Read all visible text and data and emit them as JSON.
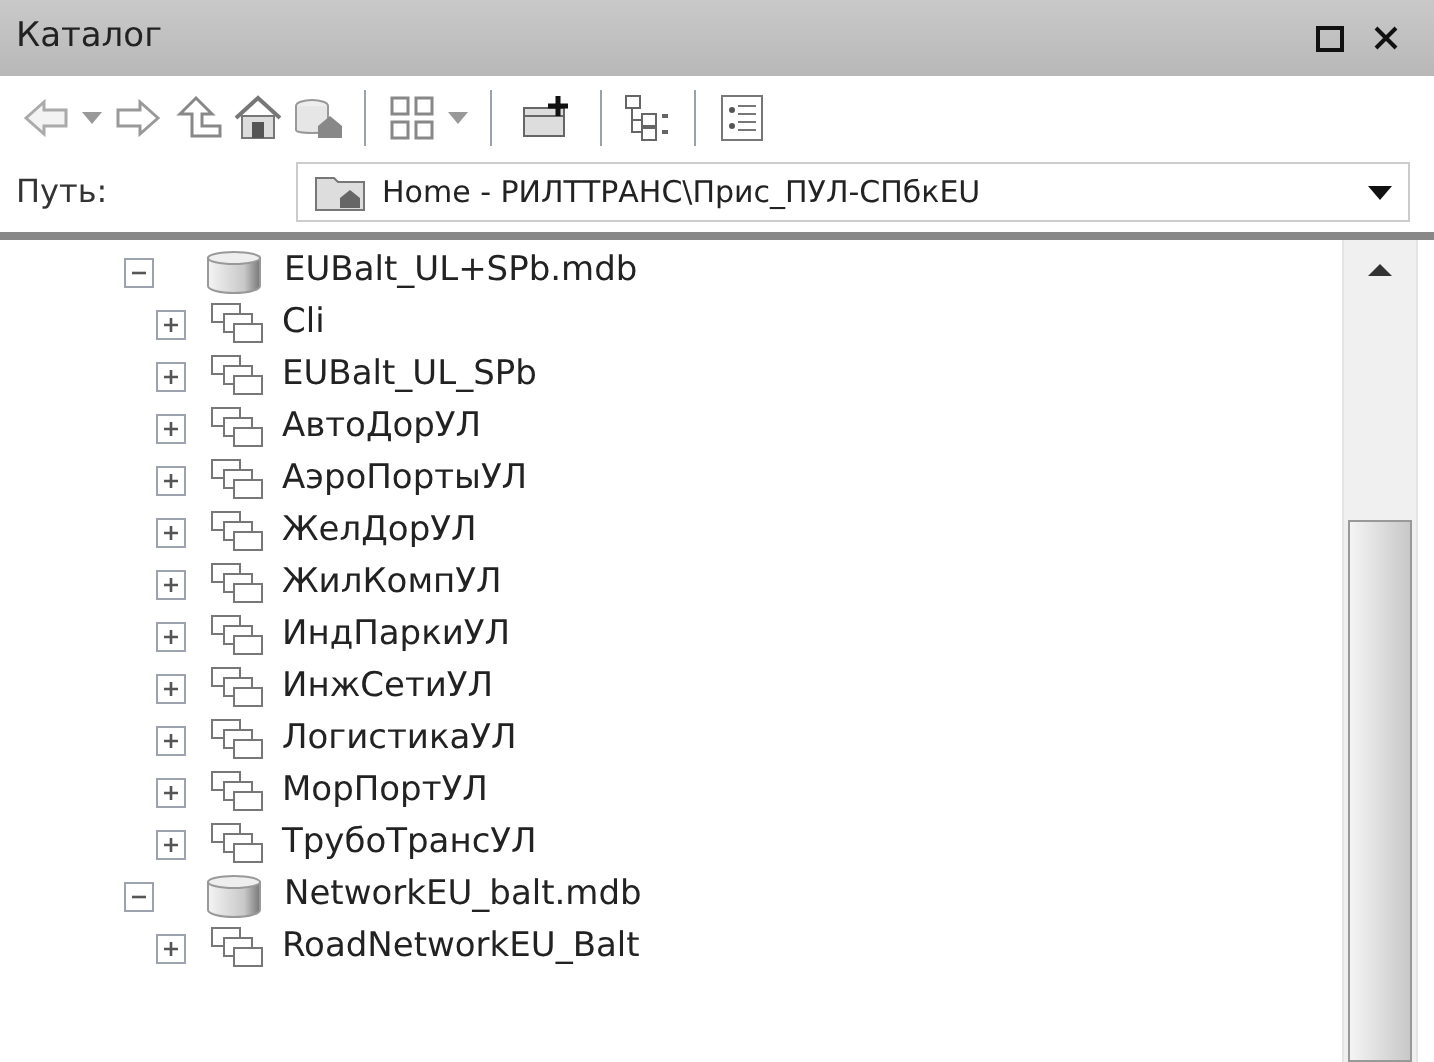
{
  "window": {
    "title": "Каталог"
  },
  "path": {
    "label": "Путь:",
    "value": "Home - РИЛТТРАНС\\Прис_ПУЛ-СПбкEU"
  },
  "tree": [
    {
      "label": "EUBalt_UL+SPb.mdb",
      "kind": "database",
      "expanded": true,
      "children": [
        {
          "label": "Cli",
          "kind": "dataset",
          "expanded": false
        },
        {
          "label": "EUBalt_UL_SPb",
          "kind": "dataset",
          "expanded": false
        },
        {
          "label": "АвтоДорУЛ",
          "kind": "dataset",
          "expanded": false
        },
        {
          "label": "АэроПортыУЛ",
          "kind": "dataset",
          "expanded": false
        },
        {
          "label": "ЖелДорУЛ",
          "kind": "dataset",
          "expanded": false
        },
        {
          "label": "ЖилКомпУЛ",
          "kind": "dataset",
          "expanded": false
        },
        {
          "label": "ИндПаркиУЛ",
          "kind": "dataset",
          "expanded": false
        },
        {
          "label": "ИнжСетиУЛ",
          "kind": "dataset",
          "expanded": false
        },
        {
          "label": "ЛогистикаУЛ",
          "kind": "dataset",
          "expanded": false
        },
        {
          "label": "МорПортУЛ",
          "kind": "dataset",
          "expanded": false
        },
        {
          "label": "ТрубоТрансУЛ",
          "kind": "dataset",
          "expanded": false
        }
      ]
    },
    {
      "label": "NetworkEU_balt.mdb",
      "kind": "database",
      "expanded": true,
      "children": [
        {
          "label": "RoadNetworkEU_Balt",
          "kind": "dataset",
          "expanded": false
        }
      ]
    }
  ]
}
